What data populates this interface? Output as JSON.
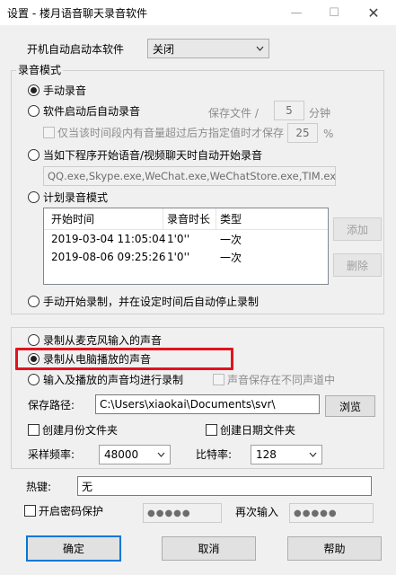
{
  "window": {
    "title": "设置 - 楼月语音聊天录音软件",
    "min_glyph": "—",
    "max_glyph": "☐",
    "close_glyph": "✕"
  },
  "autostart": {
    "label": "开机自动启动本软件",
    "value": "关闭"
  },
  "record_mode": {
    "title": "录音模式",
    "manual": "手动录音",
    "auto_after_start": "软件启动后自动录音",
    "save_file_label": "保存文件 /",
    "save_file_value": "5",
    "minutes_unit": "分钟",
    "only_when_volume": "仅当该时间段内有音量超过后方指定值时才保存",
    "volume_value": "25",
    "percent_unit": "%",
    "when_program_chat": "当如下程序开始语音/视频聊天时自动开始录音",
    "program_list": "QQ.exe,Skype.exe,WeChat.exe,WeChatStore.exe,TIM.exe",
    "scheduled": "计划录音模式",
    "schedule_table": {
      "headers": [
        "开始时间",
        "录音时长",
        "类型"
      ],
      "rows": [
        [
          "2019-03-04 11:05:04",
          "1'0''",
          "一次"
        ],
        [
          "2019-08-06 09:25:26",
          "1'0''",
          "一次"
        ]
      ]
    },
    "add_button": "添加",
    "delete_button": "删除",
    "manual_timed_stop": "手动开始录制，并在设定时间后自动停止录制"
  },
  "source": {
    "mic": "录制从麦克风输入的声音",
    "speaker": "录制从电脑播放的声音",
    "both": "输入及播放的声音均进行录制",
    "separate_channels": "声音保存在不同声道中"
  },
  "save": {
    "path_label": "保存路径:",
    "path_value": "C:\\Users\\xiaokai\\Documents\\svr\\",
    "browse_button": "浏览",
    "monthly_folder": "创建月份文件夹",
    "daily_folder": "创建日期文件夹",
    "sample_rate_label": "采样频率:",
    "sample_rate_value": "48000",
    "bitrate_label": "比特率:",
    "bitrate_value": "128"
  },
  "hotkey": {
    "label": "热键:",
    "value": "无"
  },
  "password": {
    "enable_label": "开启密码保护",
    "password_value": "●●●●●",
    "repeat_label": "再次输入",
    "repeat_value": "●●●●●"
  },
  "buttons": {
    "ok": "确定",
    "cancel": "取消",
    "help": "帮助"
  },
  "colors": {
    "highlight": "#e0141e",
    "accent": "#0078d7"
  }
}
